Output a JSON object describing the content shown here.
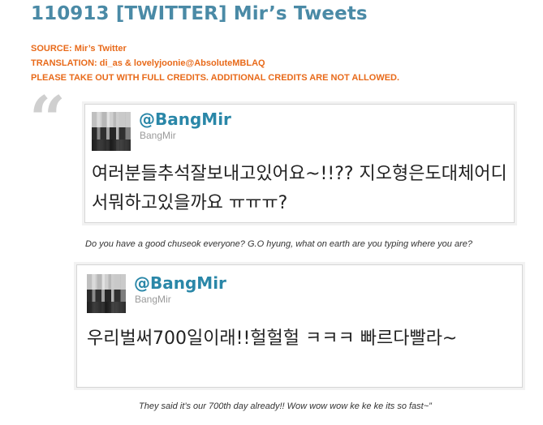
{
  "post": {
    "title": "110913 [TWITTER] Mir’s Tweets",
    "credits": {
      "source": "SOURCE: Mir’s Twitter",
      "translation": "TRANSLATION: di_as & lovelyjoonie@AbsoluteMBLAQ",
      "notice": "PLEASE TAKE OUT WITH FULL CREDITS. ADDITIONAL CREDITS ARE NOT ALLOWED."
    },
    "quote_mark": "“"
  },
  "tweets": [
    {
      "handle": "@BangMir",
      "name": "BangMir",
      "text": "여러분들추석잘보내고있어요~!!?? 지오형은도대체어디서뭐하고있을까요 ㅠㅠㅠ?",
      "translation": "Do you have a good chuseok everyone? G.O hyung, what on earth are you typing where you are?"
    },
    {
      "handle": "@BangMir",
      "name": "BangMir",
      "text": "우리벌써700일이래!!헐헐헐 ㅋㅋㅋ 빠르다빨라~",
      "translation": "They said it’s our 700th day already!! Wow wow wow ke ke ke its so fast~”"
    }
  ]
}
